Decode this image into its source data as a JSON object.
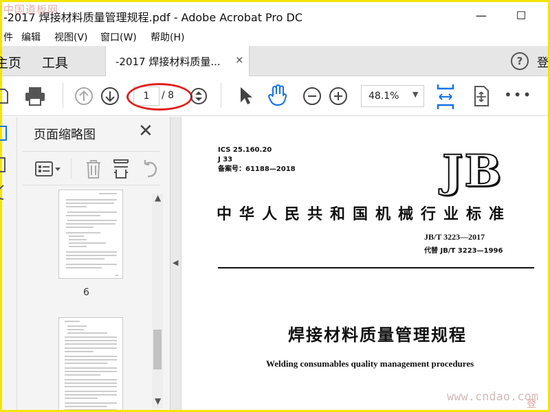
{
  "window": {
    "title": "-2017 焊接材料质量管理规程.pdf - Adobe Acrobat Pro DC",
    "minimize_glyph": "—",
    "maximize_glyph": "☐"
  },
  "watermark_top": "中国道板网",
  "menu": [
    "件",
    "编辑",
    "视图(V)",
    "窗口(W)",
    "帮助(H)"
  ],
  "tabs": {
    "home": "主页",
    "tools": "工具",
    "document": "-2017 焊接材料质量...",
    "close": "×",
    "help": "?",
    "right_cut": "登"
  },
  "toolbar": {
    "page_current": "1",
    "page_total": "/ 8",
    "zoom": "48.1%",
    "zoom_caret": "▼",
    "more": "•••"
  },
  "thumbnails": {
    "title": "页面缩略图",
    "close": "✕",
    "page_label": "6",
    "scroll_up": "▲",
    "scroll_down": "▼"
  },
  "splitter_arrow": "◀",
  "document": {
    "ics": "ICS 25.160.20",
    "ccs": "J 33",
    "record": "备案号：61188—2018",
    "logo": "JB",
    "std_title": "中华人民共和国机械行业标准",
    "std_code": "JB/T 3223—2017",
    "replaces": "代替 JB/T 3223—1996",
    "title_cn": "焊接材料质量管理规程",
    "title_en": "Welding consumables quality management procedures"
  },
  "watermark_bottom": "www.cndao.com",
  "watermark_bottom_right": "登",
  "colors": {
    "frame": "#f2e600",
    "accent_blue": "#1473e6",
    "annotation_red": "#e0201c"
  }
}
